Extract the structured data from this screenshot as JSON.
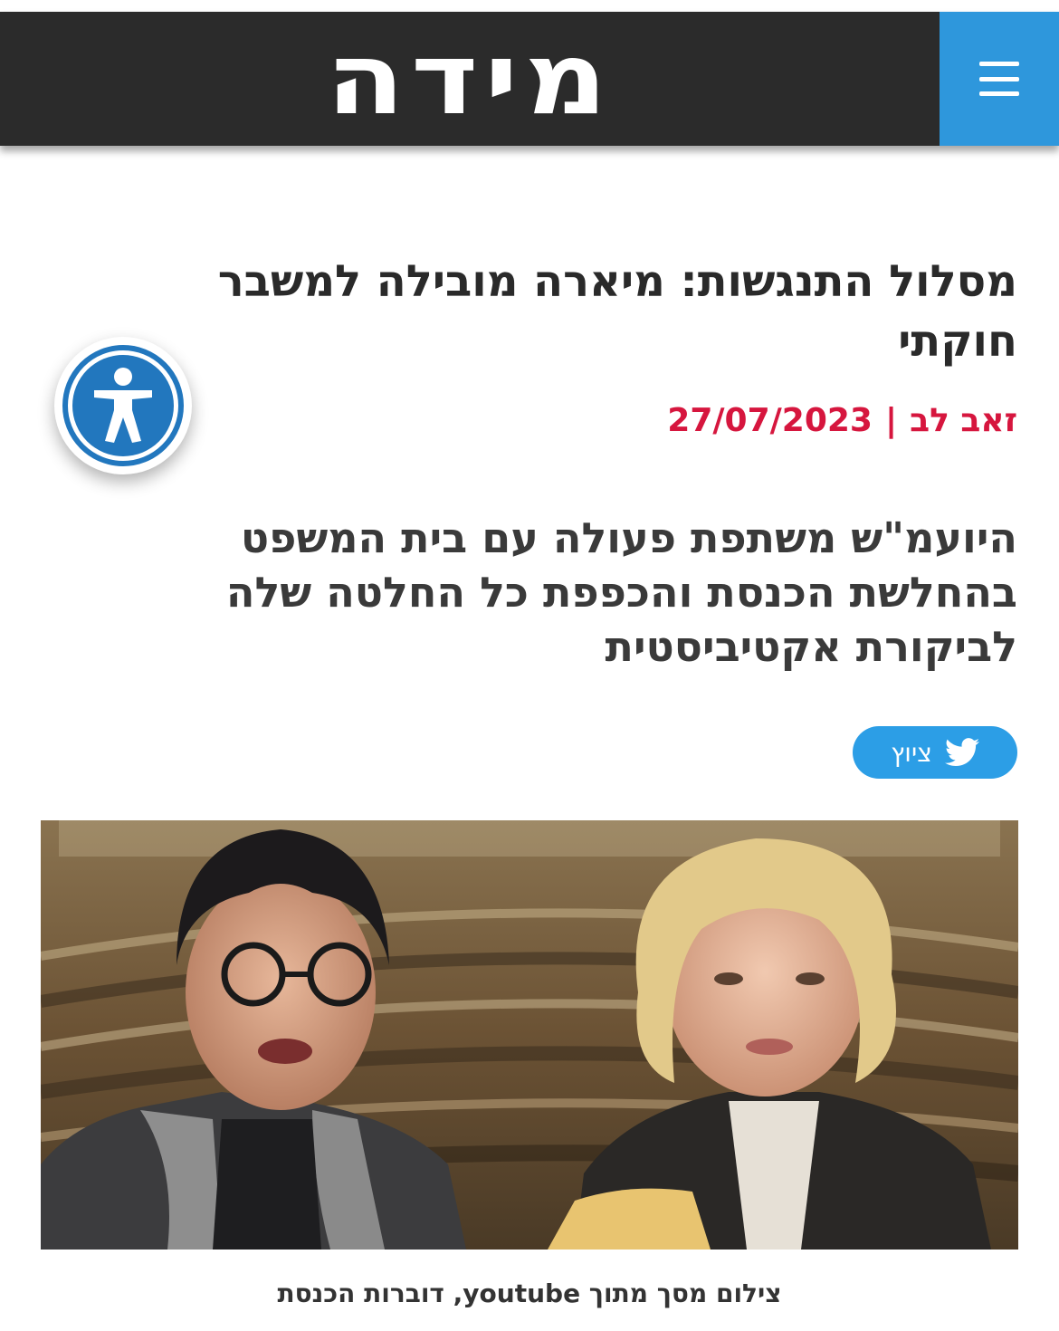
{
  "header": {
    "logo_text": "מידה",
    "menu_icon": "hamburger-menu-icon",
    "accent_color": "#2e97dc",
    "background_color": "#2b2b2b"
  },
  "article": {
    "title": "מסלול התנגשות: מיארה מובילה למשבר חוקתי",
    "author": "זאב לב",
    "separator": "|",
    "date": "27/07/2023",
    "meta_color": "#d6163e",
    "subtitle": "היועמ\"ש משתפת פעולה עם בית המשפט בהחלשת הכנסת והכפפת כל החלטה שלה לביקורת אקטיביסטית",
    "share": {
      "label": "ציוץ",
      "icon": "twitter-bird-icon",
      "color": "#2c9ee6"
    },
    "image": {
      "caption": "צילום מסך מתוך youtube, דוברות הכנסת"
    }
  },
  "accessibility": {
    "icon": "accessibility-person-icon",
    "color": "#2277be"
  }
}
